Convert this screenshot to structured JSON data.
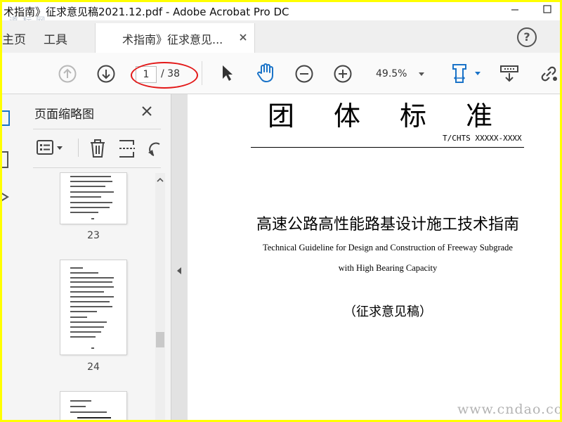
{
  "window": {
    "title": "术指南》征求意见稿2021.12.pdf - Adobe Acrobat Pro DC",
    "watermark_top": "道 标 网"
  },
  "tabs": {
    "home": "主页",
    "tools": "工具",
    "document": "术指南》征求意见...",
    "help": "?"
  },
  "toolbar": {
    "current_page": "1",
    "page_total": "/ 38",
    "zoom": "49.5%"
  },
  "thumbnail_panel": {
    "title": "页面缩略图",
    "pages": [
      {
        "number": "23"
      },
      {
        "number": "24"
      }
    ]
  },
  "document": {
    "heading": "团体标准",
    "code": "T/CHTS XXXXX-XXXX",
    "cn_title": "高速公路高性能路基设计施工技术指南",
    "en_title_line1": "Technical Guideline for Design and Construction of Freeway Subgrade",
    "en_title_line2": "with High Bearing Capacity",
    "draft_label": "（征求意见稿）"
  },
  "watermark": "www.cndao.com",
  "colors": {
    "border": "#ffff00",
    "annotation": "#e31818",
    "accent_blue": "#1a73c8"
  }
}
